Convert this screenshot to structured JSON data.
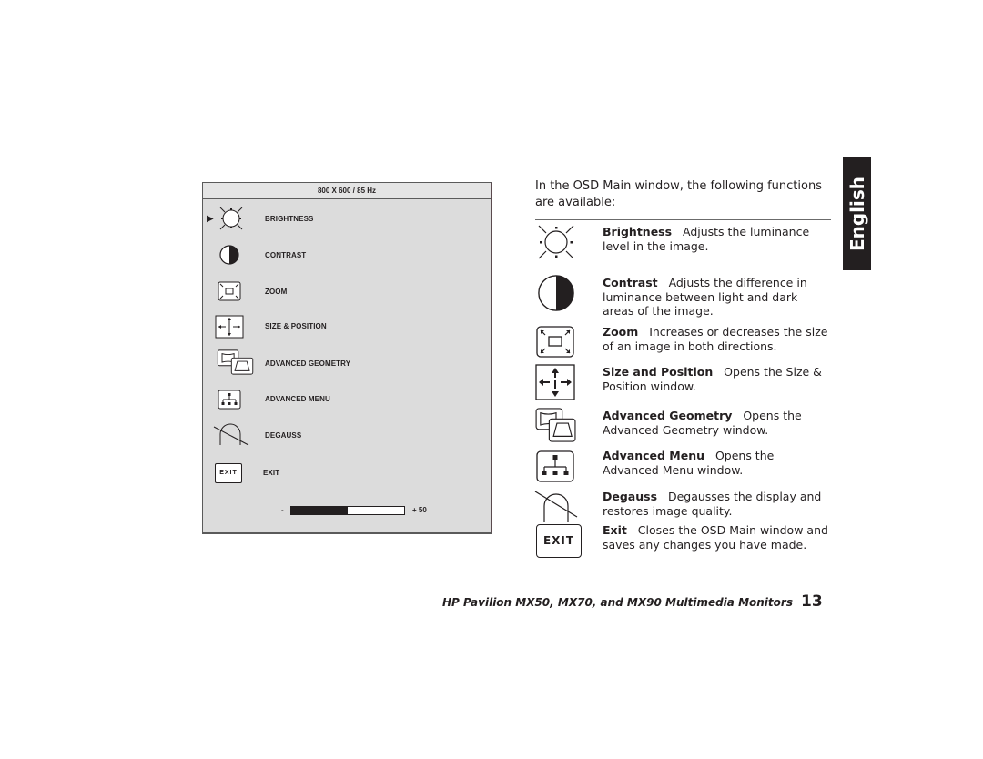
{
  "osd": {
    "title": "800 X 600 / 85 Hz",
    "selected_pointer": "▶",
    "items": [
      {
        "label": "BRIGHTNESS",
        "icon": "brightness-icon"
      },
      {
        "label": "CONTRAST",
        "icon": "contrast-icon"
      },
      {
        "label": "ZOOM",
        "icon": "zoom-icon"
      },
      {
        "label": "SIZE & POSITION",
        "icon": "size-position-icon"
      },
      {
        "label": "ADVANCED GEOMETRY",
        "icon": "advanced-geometry-icon"
      },
      {
        "label": "ADVANCED MENU",
        "icon": "advanced-menu-icon"
      },
      {
        "label": "DEGAUSS",
        "icon": "degauss-icon"
      },
      {
        "label": "EXIT",
        "icon": "exit-icon",
        "icon_text": "EXIT"
      }
    ],
    "slider": {
      "minus_label": "-",
      "plus_label": "+ 50",
      "value": 50,
      "fill_fraction": 0.5
    }
  },
  "intro": "In the OSD Main window, the following functions are available:",
  "features": [
    {
      "name": "Brightness",
      "desc": "Adjusts the luminance level in the image."
    },
    {
      "name": "Contrast",
      "desc": "Adjusts the difference in luminance between light and dark areas of the image."
    },
    {
      "name": "Zoom",
      "desc": "Increases or decreases the size of an image in both directions."
    },
    {
      "name": "Size and Position",
      "desc": "Opens the Size & Position window."
    },
    {
      "name": "Advanced Geometry",
      "desc": "Opens the Advanced Geometry window."
    },
    {
      "name": "Advanced Menu",
      "desc": "Opens the Advanced Menu window."
    },
    {
      "name": "Degauss",
      "desc": "Degausses the display and restores image quality."
    },
    {
      "name": "Exit",
      "desc": "Closes the OSD Main window and saves any changes you have made.",
      "icon_text": "EXIT"
    }
  ],
  "language_tab": "English",
  "footer": {
    "title": "HP Pavilion MX50, MX70, and MX90 Multimedia Monitors",
    "page_number": "13"
  }
}
